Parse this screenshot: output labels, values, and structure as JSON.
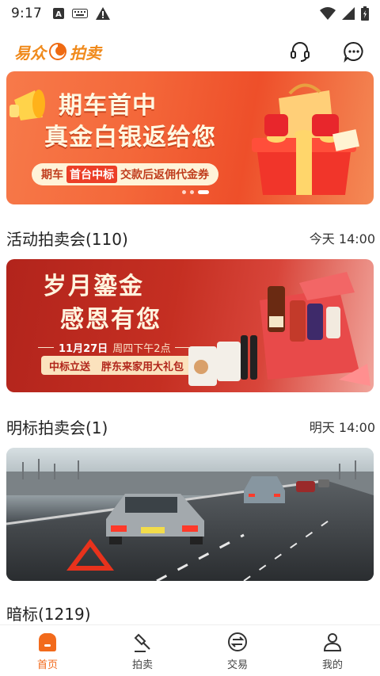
{
  "status_bar": {
    "time": "9:17",
    "icons": [
      "text-a-icon",
      "keyboard-icon",
      "warning-icon",
      "wifi-icon",
      "signal-icon",
      "battery-icon"
    ]
  },
  "app": {
    "logo_text_left": "易众",
    "logo_text_right": "拍卖",
    "brand_color": "#f08a1c",
    "header_icons": [
      "headset-icon",
      "chat-icon"
    ]
  },
  "banners": [
    {
      "headline_line1": "期车首中",
      "headline_line2": "真金白银返给您",
      "pill_prefix": "期车",
      "pill_highlight": "首台中标",
      "pill_suffix": "交款后返佣代金券",
      "carousel_dots": 3,
      "carousel_active": 3
    },
    {
      "headline_line1": "岁月鎏金",
      "headline_line2": "感恩有您",
      "date_text": "11月27日",
      "date_detail": "周四下午2点",
      "pill_left": "中标立送",
      "pill_right": "胖东来家用大礼包"
    },
    {
      "scene": "highway-traffic-photo"
    }
  ],
  "sections": [
    {
      "title": "活动拍卖会(110)",
      "time": "今天 14:00"
    },
    {
      "title": "明标拍卖会(1)",
      "time": "明天 14:00"
    },
    {
      "title": "暗标(1219)",
      "time": ""
    }
  ],
  "bottom_nav": {
    "active_color": "#f26a1b",
    "tabs": [
      {
        "label": "首页",
        "icon": "home-icon",
        "active": true
      },
      {
        "label": "拍卖",
        "icon": "gavel-icon",
        "active": false
      },
      {
        "label": "交易",
        "icon": "exchange-icon",
        "active": false
      },
      {
        "label": "我的",
        "icon": "profile-icon",
        "active": false
      }
    ]
  }
}
